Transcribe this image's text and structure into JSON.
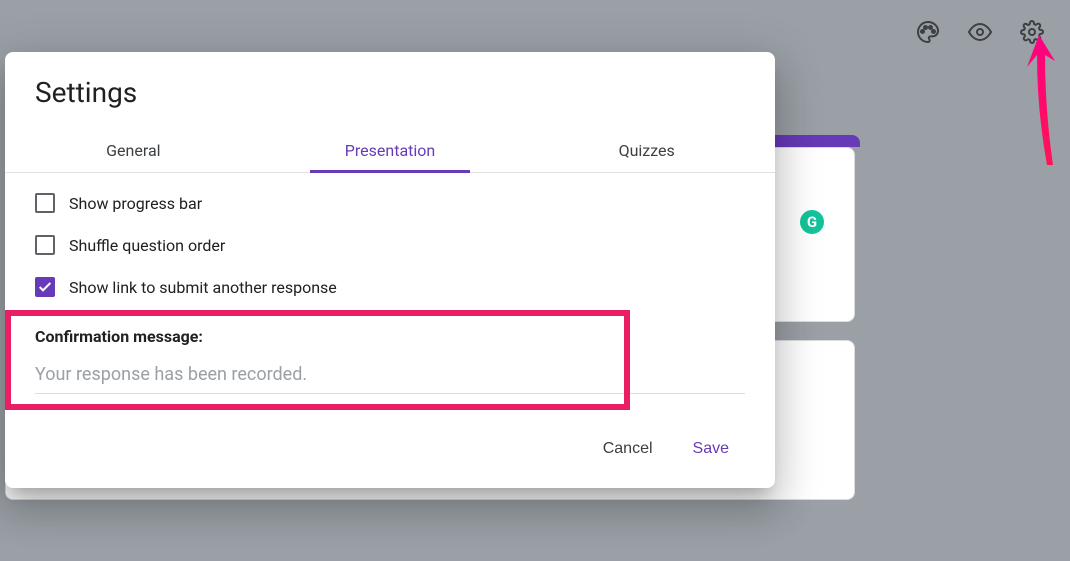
{
  "dialog": {
    "title": "Settings",
    "tabs": {
      "general": "General",
      "presentation": "Presentation",
      "quizzes": "Quizzes"
    },
    "options": {
      "show_progress_bar": "Show progress bar",
      "shuffle_question_order": "Shuffle question order",
      "show_link_submit_another": "Show link to submit another response"
    },
    "confirmation_label": "Confirmation message:",
    "confirmation_placeholder": "Your response has been recorded.",
    "actions": {
      "cancel": "Cancel",
      "save": "Save"
    }
  },
  "toolbar": {
    "palette_icon": "palette-icon",
    "eye_icon": "eye-icon",
    "gear_icon": "gear-icon"
  },
  "grammarly": "G",
  "colors": {
    "accent": "#673ab7",
    "highlight": "#e91e63",
    "grammarly": "#15c39a"
  }
}
